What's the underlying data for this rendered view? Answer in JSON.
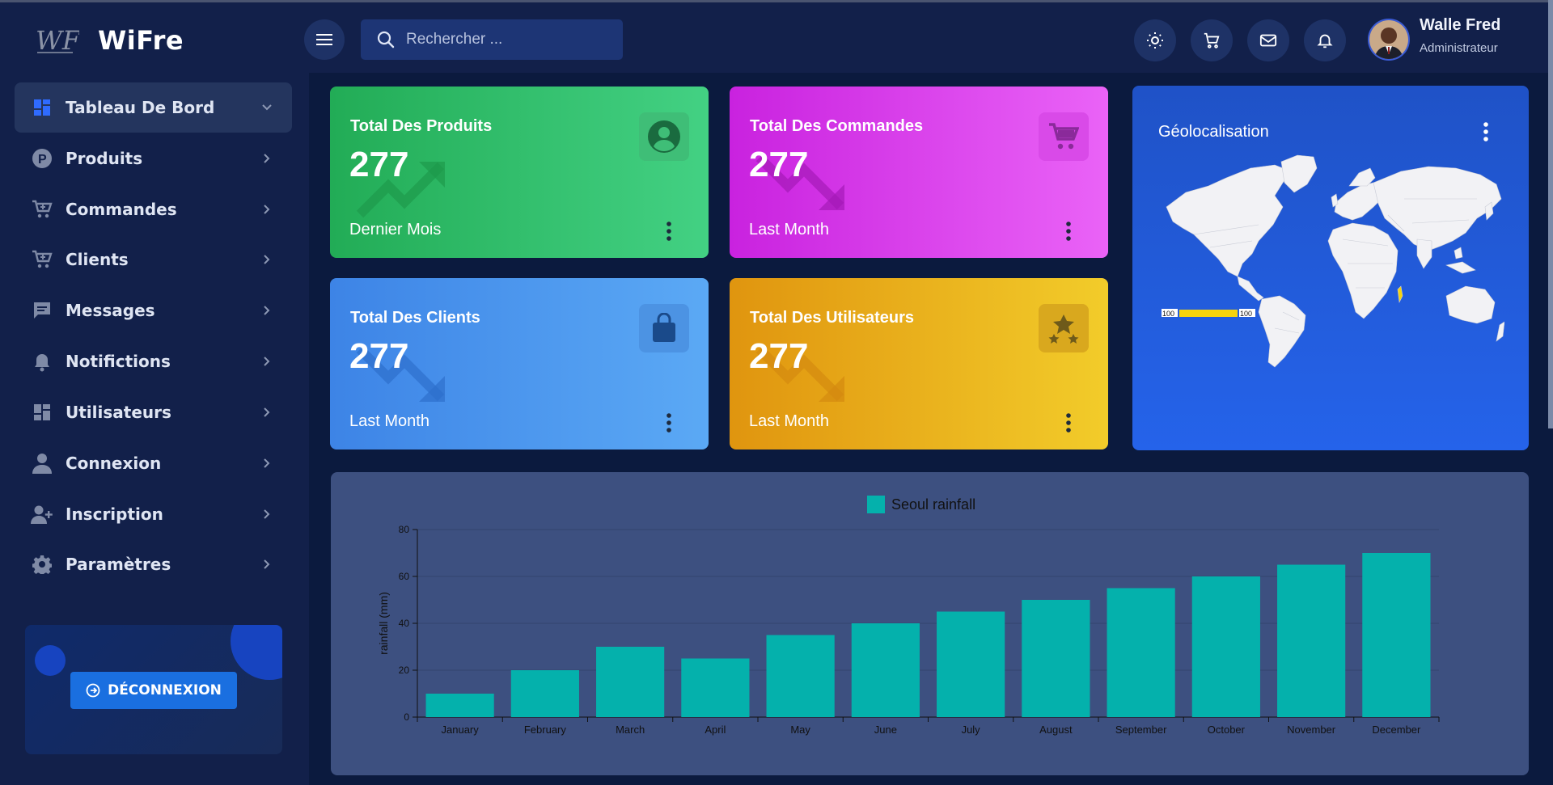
{
  "brand": {
    "name": "WiFre",
    "logo_text": "WF"
  },
  "search": {
    "placeholder": "Rechercher ..."
  },
  "header_icons": [
    "sun-icon",
    "cart-icon",
    "mail-icon",
    "bell-icon"
  ],
  "user": {
    "name": "Walle Fred",
    "role": "Administrateur"
  },
  "sidebar": {
    "items": [
      {
        "label": "Tableau De Bord",
        "icon": "dashboard-icon",
        "active": true
      },
      {
        "label": "Produits",
        "icon": "product-icon"
      },
      {
        "label": "Commandes",
        "icon": "cart-icon"
      },
      {
        "label": "Clients",
        "icon": "cart-icon"
      },
      {
        "label": "Messages",
        "icon": "message-icon"
      },
      {
        "label": "Notifictions",
        "icon": "bell-icon"
      },
      {
        "label": "Utilisateurs",
        "icon": "dashboard-icon"
      },
      {
        "label": "Connexion",
        "icon": "user-icon"
      },
      {
        "label": "Inscription",
        "icon": "user-add-icon"
      },
      {
        "label": "Paramètres",
        "icon": "gear-icon"
      }
    ],
    "logout_label": "DÉCONNEXION"
  },
  "cards": [
    {
      "title": "Total Des Produits",
      "value": "277",
      "footer": "Dernier Mois",
      "icon": "user-circle-icon",
      "trend": "up"
    },
    {
      "title": "Total Des Commandes",
      "value": "277",
      "footer": "Last Month",
      "icon": "cart-icon",
      "trend": "down"
    },
    {
      "title": "Total Des Clients",
      "value": "277",
      "footer": "Last Month",
      "icon": "bag-icon",
      "trend": "down"
    },
    {
      "title": "Total Des Utilisateurs",
      "value": "277",
      "footer": "Last Month",
      "icon": "stars-icon",
      "trend": "down"
    }
  ],
  "geo": {
    "title": "Géolocalisation",
    "scale_min": "100",
    "scale_max": "100"
  },
  "colors": {
    "card_green": "#22b05a",
    "card_magenta": "#d63ae8",
    "card_blue": "#4a90e8",
    "card_orange": "#e8a418",
    "bar": "#04b1ac"
  },
  "chart_data": {
    "type": "bar",
    "categories": [
      "January",
      "February",
      "March",
      "April",
      "May",
      "June",
      "July",
      "August",
      "September",
      "October",
      "November",
      "December"
    ],
    "series": [
      {
        "name": "Seoul rainfall",
        "values": [
          10,
          20,
          30,
          25,
          35,
          40,
          45,
          50,
          55,
          60,
          65,
          70
        ]
      }
    ],
    "ylabel": "rainfall (mm)",
    "ylim": [
      0,
      80
    ],
    "yticks": [
      0,
      20,
      40,
      60,
      80
    ],
    "legend": "top-center",
    "grid": true
  }
}
